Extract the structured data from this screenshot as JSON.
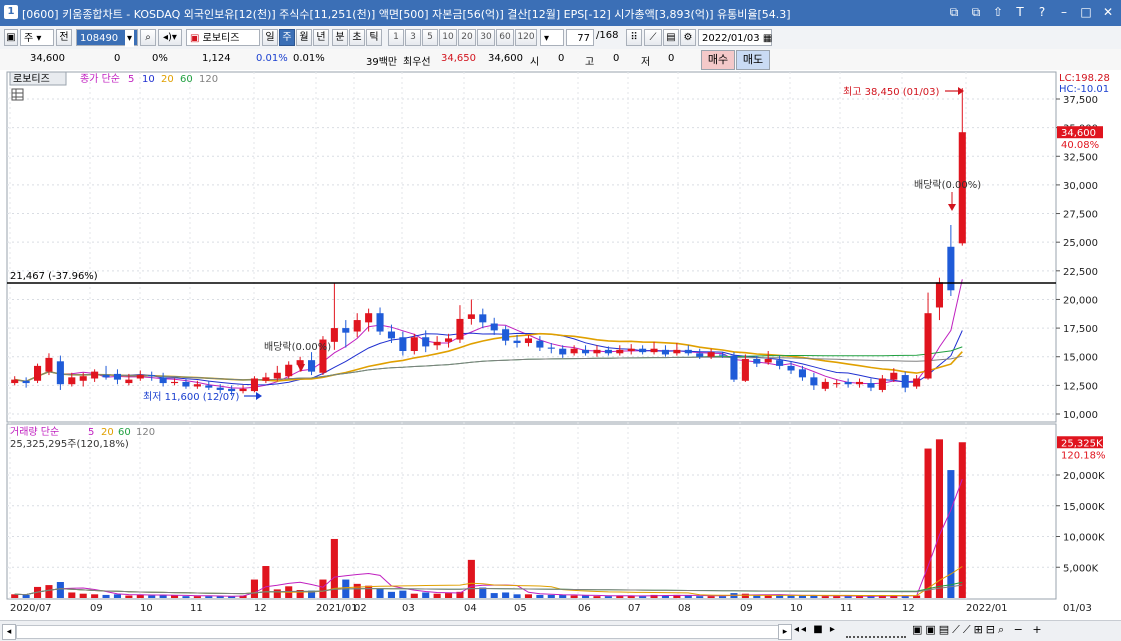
{
  "window": {
    "title": "[0600] 키움종합차트 - KOSDAQ 외국인보유[12(천)] 주식수[11,251(천)] 액면[500] 자본금[56(억)] 결산[12월] EPS[-12] 시가총액[3,893(억)] 유통비율[54.3]",
    "app_icon_label": "1",
    "buttons": [
      "⧉",
      "⧉",
      "⇧",
      "T",
      "?",
      "–",
      "□",
      "✕"
    ]
  },
  "toolbar1": {
    "market": "주",
    "prev": "전",
    "code": "108490",
    "stock_name": "로보티즈",
    "periods": [
      "일",
      "주",
      "월",
      "년",
      "분",
      "초",
      "틱"
    ],
    "active_period": "주",
    "intervals": [
      "1",
      "3",
      "5",
      "10",
      "20",
      "30",
      "60",
      "120"
    ],
    "count": "77",
    "total": "/168",
    "date": "2022/01/03"
  },
  "quote": {
    "price": "34,600",
    "change": "0",
    "change_pct": "0%",
    "volume": "1,124",
    "vol_pct1": "0.01%",
    "vol_pct2": "0.01%",
    "unit": "39백만",
    "best_ask_label": "최우선",
    "best_ask": "34,650",
    "best_bid": "34,600",
    "open_label": "시",
    "open": "0",
    "high_label": "고",
    "high": "0",
    "low_label": "저",
    "low": "0",
    "buy": "매수",
    "sell": "매도"
  },
  "price_panel": {
    "name": "로보티즈",
    "legend_prefix": "종가 단순",
    "ma_labels": [
      "5",
      "10",
      "20",
      "60",
      "120"
    ],
    "ma_colors": [
      "#c020c0",
      "#2030d0",
      "#e0a000",
      "#20a040",
      "#808080"
    ],
    "hline_label": "21,467 (-37.96%)",
    "max_label": "최고 38,450 (01/03)",
    "min_label": "최저 11,600 (12/07)",
    "div_label_1": "배당락(0.00%)",
    "div_label_2": "배당락(0.00%)",
    "lc_label": "LC:198.28",
    "hc_label": "HC:-10.01",
    "current_price_tag": "34,600",
    "current_pct_tag": "40.08%",
    "y_ticks": [
      "37,500",
      "35,000",
      "32,500",
      "30,000",
      "27,500",
      "25,000",
      "22,500",
      "20,000",
      "17,500",
      "15,000",
      "12,500",
      "10,000"
    ]
  },
  "volume_panel": {
    "legend_prefix": "거래량 단순",
    "ma_labels": [
      "5",
      "20",
      "60",
      "120"
    ],
    "ma_colors": [
      "#c020c0",
      "#e0a000",
      "#20a040",
      "#808080"
    ],
    "sub_label": "25,325,295주(120,18%)",
    "tag_value": "25,325K",
    "tag_pct": "120.18%",
    "y_ticks": [
      "20,000K",
      "15,000K",
      "10,000K",
      "5,000K"
    ]
  },
  "x_axis": {
    "labels": [
      "2020/07",
      "09",
      "10",
      "11",
      "12",
      "2021/01",
      "02",
      "03",
      "04",
      "05",
      "06",
      "07",
      "08",
      "09",
      "10",
      "11",
      "12",
      "2022/01",
      "01/03"
    ]
  },
  "chart_data": {
    "type": "candlestick",
    "interval": "weekly",
    "ylim": [
      9000,
      39000
    ],
    "volume_ylim": [
      0,
      27000
    ],
    "candles": [
      {
        "o": 12700,
        "c": 13000,
        "h": 13300,
        "l": 12500,
        "v": 600
      },
      {
        "o": 12900,
        "c": 12700,
        "h": 13200,
        "l": 12300,
        "v": 500
      },
      {
        "o": 12900,
        "c": 14200,
        "h": 14400,
        "l": 12700,
        "v": 1800
      },
      {
        "o": 13700,
        "c": 14900,
        "h": 15300,
        "l": 13400,
        "v": 2100
      },
      {
        "o": 14600,
        "c": 12600,
        "h": 15100,
        "l": 12100,
        "v": 2600
      },
      {
        "o": 12600,
        "c": 13200,
        "h": 13600,
        "l": 12400,
        "v": 900
      },
      {
        "o": 12900,
        "c": 13300,
        "h": 13600,
        "l": 12400,
        "v": 700
      },
      {
        "o": 13100,
        "c": 13700,
        "h": 13900,
        "l": 12800,
        "v": 600
      },
      {
        "o": 13400,
        "c": 13200,
        "h": 14200,
        "l": 13000,
        "v": 500
      },
      {
        "o": 13500,
        "c": 13000,
        "h": 13900,
        "l": 12600,
        "v": 600
      },
      {
        "o": 12700,
        "c": 13000,
        "h": 13500,
        "l": 12500,
        "v": 400
      },
      {
        "o": 13100,
        "c": 13400,
        "h": 13800,
        "l": 12900,
        "v": 500
      },
      {
        "o": 13400,
        "c": 13300,
        "h": 13700,
        "l": 12900,
        "v": 400
      },
      {
        "o": 13200,
        "c": 12700,
        "h": 13600,
        "l": 12400,
        "v": 500
      },
      {
        "o": 12700,
        "c": 12800,
        "h": 13100,
        "l": 12500,
        "v": 400
      },
      {
        "o": 12800,
        "c": 12400,
        "h": 13100,
        "l": 12200,
        "v": 300
      },
      {
        "o": 12400,
        "c": 12600,
        "h": 12900,
        "l": 12200,
        "v": 300
      },
      {
        "o": 12500,
        "c": 12300,
        "h": 12900,
        "l": 12100,
        "v": 300
      },
      {
        "o": 12300,
        "c": 12100,
        "h": 12600,
        "l": 11800,
        "v": 300
      },
      {
        "o": 12200,
        "c": 12000,
        "h": 12500,
        "l": 11600,
        "v": 300
      },
      {
        "o": 12000,
        "c": 12200,
        "h": 12500,
        "l": 11800,
        "v": 400
      },
      {
        "o": 12000,
        "c": 13100,
        "h": 13300,
        "l": 11900,
        "v": 3000
      },
      {
        "o": 12900,
        "c": 13200,
        "h": 13600,
        "l": 12700,
        "v": 5200
      },
      {
        "o": 13100,
        "c": 13600,
        "h": 14200,
        "l": 12900,
        "v": 1400
      },
      {
        "o": 13300,
        "c": 14300,
        "h": 14600,
        "l": 13100,
        "v": 1900
      },
      {
        "o": 14300,
        "c": 14700,
        "h": 15000,
        "l": 13700,
        "v": 1300
      },
      {
        "o": 14700,
        "c": 13700,
        "h": 15400,
        "l": 13400,
        "v": 1200
      },
      {
        "o": 13600,
        "c": 16500,
        "h": 16800,
        "l": 13400,
        "v": 3000
      },
      {
        "o": 16300,
        "c": 17500,
        "h": 21400,
        "l": 15600,
        "v": 9600
      },
      {
        "o": 17500,
        "c": 17100,
        "h": 18200,
        "l": 15800,
        "v": 3000
      },
      {
        "o": 17200,
        "c": 18200,
        "h": 18800,
        "l": 16700,
        "v": 2300
      },
      {
        "o": 18000,
        "c": 18800,
        "h": 19200,
        "l": 17200,
        "v": 2000
      },
      {
        "o": 18800,
        "c": 17200,
        "h": 19300,
        "l": 16900,
        "v": 1500
      },
      {
        "o": 17200,
        "c": 16600,
        "h": 17800,
        "l": 16200,
        "v": 1000
      },
      {
        "o": 16700,
        "c": 15500,
        "h": 17200,
        "l": 15100,
        "v": 1200
      },
      {
        "o": 15500,
        "c": 16700,
        "h": 17000,
        "l": 15200,
        "v": 700
      },
      {
        "o": 16700,
        "c": 15900,
        "h": 17300,
        "l": 15400,
        "v": 900
      },
      {
        "o": 16000,
        "c": 16300,
        "h": 16800,
        "l": 15600,
        "v": 700
      },
      {
        "o": 16300,
        "c": 16600,
        "h": 17000,
        "l": 15800,
        "v": 800
      },
      {
        "o": 16500,
        "c": 18300,
        "h": 19500,
        "l": 16200,
        "v": 1000
      },
      {
        "o": 18300,
        "c": 18700,
        "h": 20000,
        "l": 17800,
        "v": 6200
      },
      {
        "o": 18700,
        "c": 18000,
        "h": 19200,
        "l": 17500,
        "v": 1700
      },
      {
        "o": 17900,
        "c": 17300,
        "h": 18400,
        "l": 16900,
        "v": 800
      },
      {
        "o": 17400,
        "c": 16400,
        "h": 17700,
        "l": 16000,
        "v": 900
      },
      {
        "o": 16400,
        "c": 16200,
        "h": 16900,
        "l": 15800,
        "v": 600
      },
      {
        "o": 16200,
        "c": 16600,
        "h": 16900,
        "l": 15900,
        "v": 600
      },
      {
        "o": 16400,
        "c": 15800,
        "h": 16800,
        "l": 15500,
        "v": 500
      },
      {
        "o": 15800,
        "c": 15700,
        "h": 16200,
        "l": 15300,
        "v": 500
      },
      {
        "o": 15700,
        "c": 15200,
        "h": 16000,
        "l": 14900,
        "v": 500
      },
      {
        "o": 15300,
        "c": 15700,
        "h": 16000,
        "l": 15100,
        "v": 400
      },
      {
        "o": 15600,
        "c": 15300,
        "h": 16000,
        "l": 15100,
        "v": 400
      },
      {
        "o": 15300,
        "c": 15600,
        "h": 16000,
        "l": 15000,
        "v": 300
      },
      {
        "o": 15600,
        "c": 15300,
        "h": 15900,
        "l": 15100,
        "v": 300
      },
      {
        "o": 15300,
        "c": 15600,
        "h": 16000,
        "l": 15100,
        "v": 400
      },
      {
        "o": 15500,
        "c": 15700,
        "h": 16100,
        "l": 15200,
        "v": 400
      },
      {
        "o": 15700,
        "c": 15400,
        "h": 16000,
        "l": 15200,
        "v": 300
      },
      {
        "o": 15400,
        "c": 15700,
        "h": 16300,
        "l": 15200,
        "v": 500
      },
      {
        "o": 15600,
        "c": 15200,
        "h": 16000,
        "l": 15000,
        "v": 400
      },
      {
        "o": 15300,
        "c": 15600,
        "h": 16200,
        "l": 15100,
        "v": 500
      },
      {
        "o": 15600,
        "c": 15300,
        "h": 16000,
        "l": 15100,
        "v": 400
      },
      {
        "o": 15300,
        "c": 15000,
        "h": 15700,
        "l": 14800,
        "v": 300
      },
      {
        "o": 15000,
        "c": 15400,
        "h": 15700,
        "l": 14800,
        "v": 300
      },
      {
        "o": 15200,
        "c": 15100,
        "h": 15400,
        "l": 14900,
        "v": 300
      },
      {
        "o": 15100,
        "c": 13000,
        "h": 15400,
        "l": 12800,
        "v": 800
      },
      {
        "o": 12900,
        "c": 14800,
        "h": 15200,
        "l": 12800,
        "v": 700
      },
      {
        "o": 14800,
        "c": 14400,
        "h": 15100,
        "l": 14100,
        "v": 400
      },
      {
        "o": 14500,
        "c": 14800,
        "h": 15500,
        "l": 14300,
        "v": 500
      },
      {
        "o": 14700,
        "c": 14200,
        "h": 15100,
        "l": 13900,
        "v": 400
      },
      {
        "o": 14200,
        "c": 13800,
        "h": 14600,
        "l": 13500,
        "v": 400
      },
      {
        "o": 13900,
        "c": 13200,
        "h": 14200,
        "l": 12900,
        "v": 400
      },
      {
        "o": 13200,
        "c": 12500,
        "h": 13600,
        "l": 12100,
        "v": 400
      },
      {
        "o": 12200,
        "c": 12800,
        "h": 13100,
        "l": 12000,
        "v": 300
      },
      {
        "o": 12600,
        "c": 12700,
        "h": 13000,
        "l": 12300,
        "v": 300
      },
      {
        "o": 12800,
        "c": 12600,
        "h": 13100,
        "l": 12300,
        "v": 300
      },
      {
        "o": 12600,
        "c": 12800,
        "h": 13100,
        "l": 12300,
        "v": 300
      },
      {
        "o": 12700,
        "c": 12300,
        "h": 13100,
        "l": 12000,
        "v": 300
      },
      {
        "o": 12100,
        "c": 13100,
        "h": 13400,
        "l": 11900,
        "v": 400
      },
      {
        "o": 13000,
        "c": 13600,
        "h": 14000,
        "l": 12800,
        "v": 400
      },
      {
        "o": 13400,
        "c": 12300,
        "h": 13700,
        "l": 11900,
        "v": 300
      },
      {
        "o": 12400,
        "c": 13100,
        "h": 13400,
        "l": 12200,
        "v": 400
      },
      {
        "o": 13100,
        "c": 18800,
        "h": 20600,
        "l": 13000,
        "v": 24300
      },
      {
        "o": 19300,
        "c": 21500,
        "h": 21900,
        "l": 18200,
        "v": 25800
      },
      {
        "o": 24600,
        "c": 20800,
        "h": 26500,
        "l": 20300,
        "v": 20800
      },
      {
        "o": 24900,
        "c": 34600,
        "h": 38450,
        "l": 24700,
        "v": 25325
      }
    ]
  }
}
